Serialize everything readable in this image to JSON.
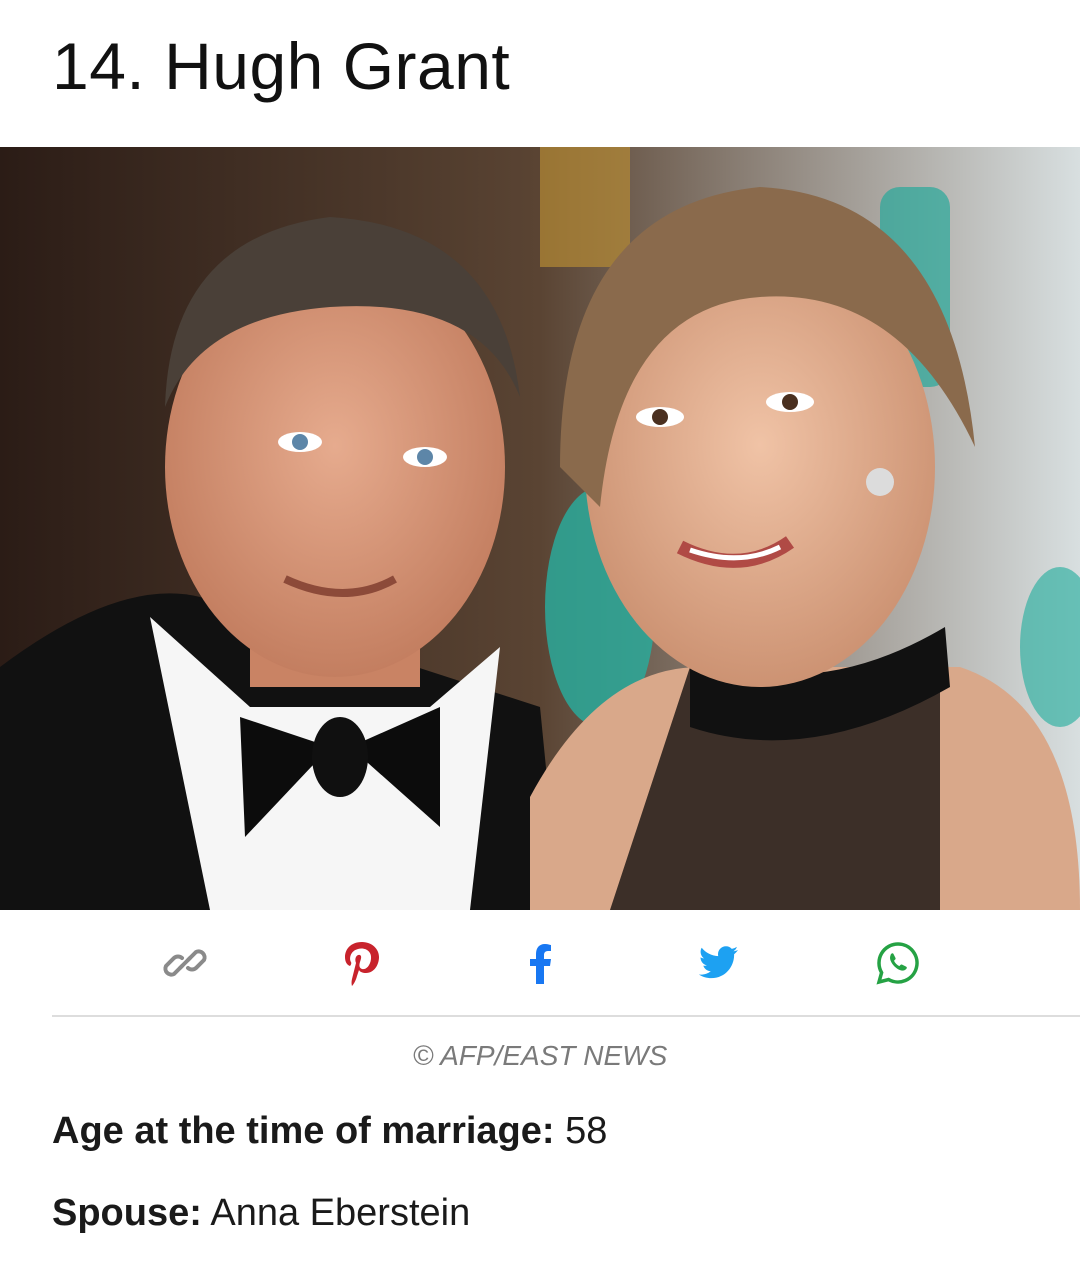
{
  "article": {
    "title": "14. Hugh Grant",
    "photo_alt": "",
    "credit": "© AFP/EAST NEWS",
    "facts": [
      {
        "label": "Age at the time of marriage:",
        "value": " 58"
      },
      {
        "label": "Spouse:",
        "value": " Anna Eberstein"
      }
    ]
  },
  "share": {
    "buttons": [
      {
        "name": "copy-link",
        "icon": "link-icon",
        "color": "#8a8a8a"
      },
      {
        "name": "pinterest",
        "icon": "pinterest-icon",
        "color": "#c8232c"
      },
      {
        "name": "facebook",
        "icon": "facebook-icon",
        "color": "#1877f2"
      },
      {
        "name": "twitter",
        "icon": "twitter-icon",
        "color": "#1da1f2"
      },
      {
        "name": "whatsapp",
        "icon": "whatsapp-icon",
        "color": "#25a244"
      }
    ]
  }
}
